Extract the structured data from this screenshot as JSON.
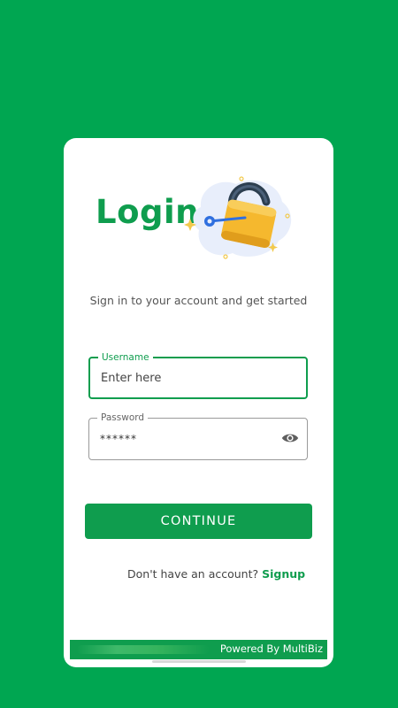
{
  "header": {
    "title": "Login",
    "subtitle": "Sign in to your account and get started"
  },
  "username": {
    "label": "Username",
    "placeholder": "Enter here",
    "value": ""
  },
  "password": {
    "label": "Password",
    "value": "******",
    "toggle_icon": "eye-icon"
  },
  "actions": {
    "continue_label": "CONTINUE"
  },
  "signup": {
    "prompt": "Don't have an account?",
    "link_label": "Signup"
  },
  "footer": {
    "powered_by": "Powered By MultiBiz"
  },
  "colors": {
    "background": "#00a651",
    "accent": "#0f9d4e",
    "card": "#ffffff",
    "lock_body": "#f5b82e",
    "key": "#2f6fdf"
  },
  "illustration": {
    "icon": "padlock-with-key-icon"
  }
}
